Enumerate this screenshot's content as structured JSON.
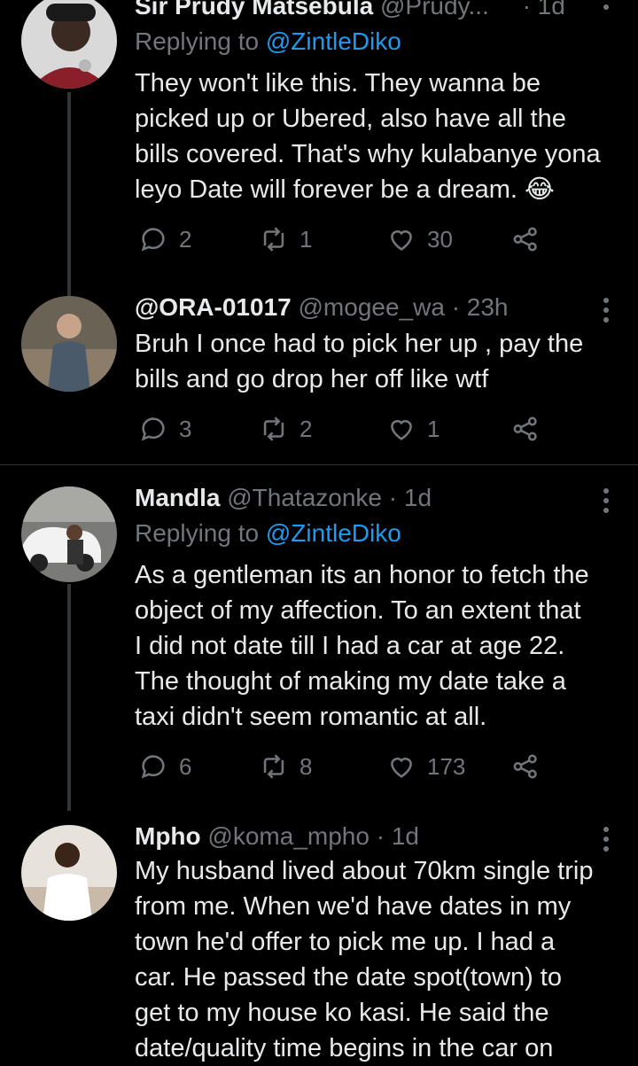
{
  "tweets": [
    {
      "name": "Sir Prudy Matsebula",
      "handle": "@Prudy...",
      "time": "· 1d",
      "replying_prefix": "Replying to ",
      "replying_to": "@ZintleDiko",
      "text": "They won't like this. They wanna be\npicked up or Ubered, also have all the\nbills covered. That's why kulabanye yona\nleyo Date will forever be a dream. 😂",
      "replies": "2",
      "retweets": "1",
      "likes": "30"
    },
    {
      "name": "@ORA-01017",
      "handle": "@mogee_wa",
      "time": "· 23h",
      "text": "Bruh I once had to pick her up , pay the\nbills and go drop her off like wtf",
      "replies": "3",
      "retweets": "2",
      "likes": "1"
    },
    {
      "name": "Mandla",
      "handle": "@Thatazonke",
      "time": "· 1d",
      "replying_prefix": "Replying to ",
      "replying_to": "@ZintleDiko",
      "text": "As a gentleman its an honor to fetch the\nobject of my affection. To an extent that\nI did not date till I had a car at age 22.\nThe thought of making my date take a\ntaxi didn't seem romantic at all.",
      "replies": "6",
      "retweets": "8",
      "likes": "173"
    },
    {
      "name": "Mpho",
      "handle": "@koma_mpho",
      "time": "· 1d",
      "text": "My husband lived about 70km single trip\nfrom me. When we'd have dates in my\ntown he'd offer to pick me up. I had a\ncar. He passed the date spot(town) to\nget to my house ko kasi. He said the\ndate/quality time begins in the car on"
    }
  ],
  "icons": {
    "reply": "reply-icon",
    "retweet": "retweet-icon",
    "like": "heart-icon",
    "share": "share-icon",
    "more": "more-options-icon"
  },
  "colors": {
    "background": "#000000",
    "text": "#e7e9ea",
    "muted": "#71767b",
    "link": "#1d9bf0"
  }
}
